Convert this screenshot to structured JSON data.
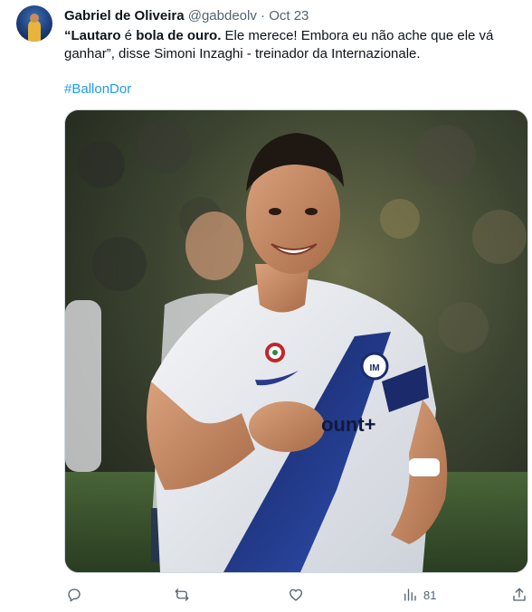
{
  "tweet": {
    "author_name": "Gabriel de Oliveira",
    "author_handle": "@gabdeolv",
    "separator": "·",
    "date": "Oct 23",
    "text_bold_1": "“Lautaro",
    "text_part_1": " é ",
    "text_bold_2": "bola de ouro.",
    "text_part_2": " Ele merece! Embora eu não ache que ele vá ganhar”, disse Simoni Inzaghi - treinador da Internazionale.",
    "hashtag": "#BallonDor",
    "media": {
      "jersey_sponsor_text": "ount+"
    },
    "actions": {
      "reply_icon": "reply-icon",
      "retweet_icon": "retweet-icon",
      "like_icon": "like-icon",
      "views_icon": "views-icon",
      "views_count": "81",
      "share_icon": "share-icon"
    }
  }
}
